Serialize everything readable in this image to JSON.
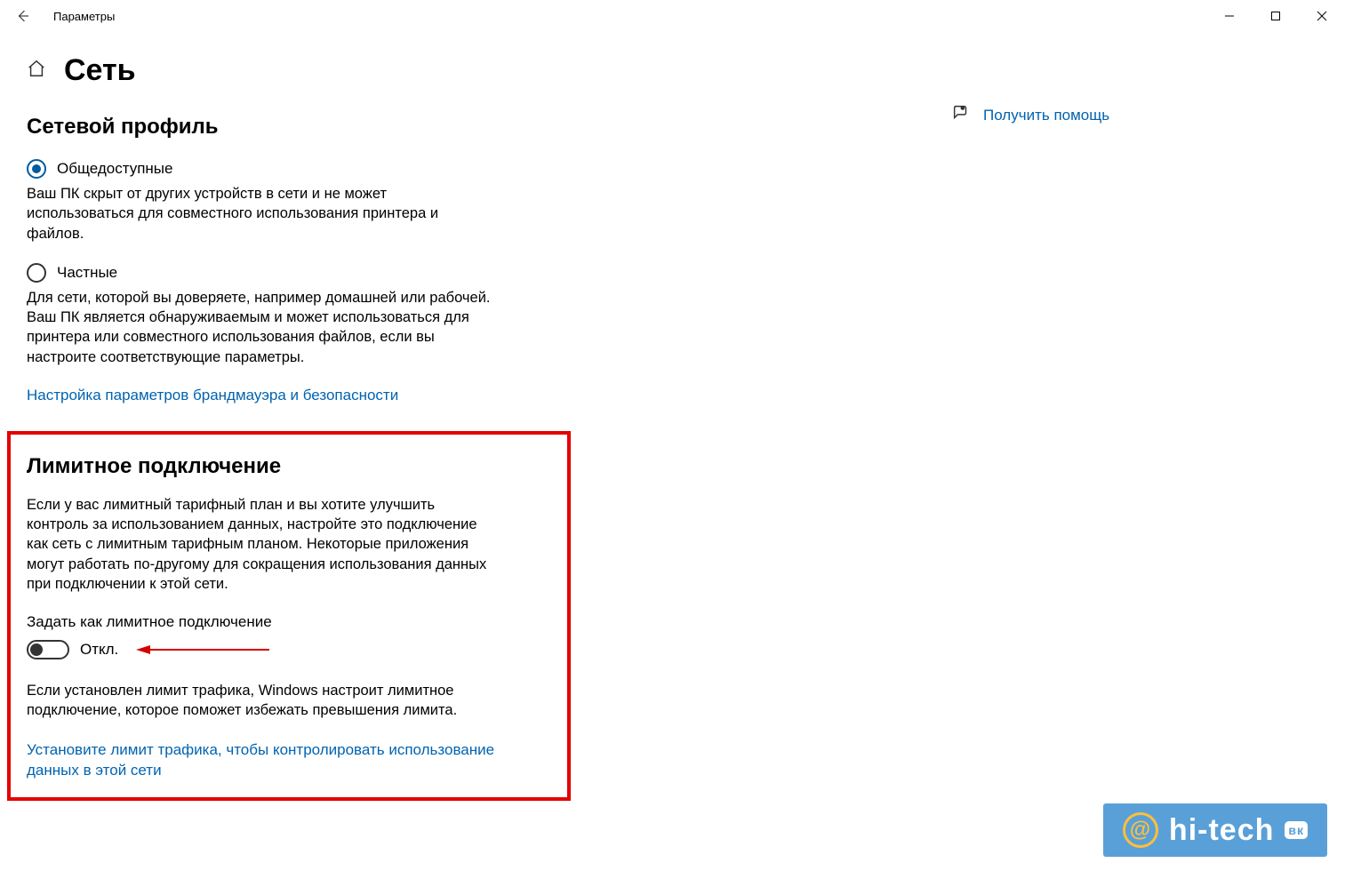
{
  "window": {
    "title": "Параметры"
  },
  "page": {
    "title": "Сеть"
  },
  "network_profile": {
    "heading": "Сетевой профиль",
    "public": {
      "label": "Общедоступные",
      "desc": "Ваш ПК скрыт от других устройств в сети и не может использоваться для совместного использования принтера и файлов."
    },
    "private": {
      "label": "Частные",
      "desc": "Для сети, которой вы доверяете, например домашней или рабочей. Ваш ПК является обнаруживаемым и может использоваться для принтера или совместного использования файлов, если вы настроите соответствующие параметры."
    },
    "firewall_link": "Настройка параметров брандмауэра и безопасности"
  },
  "metered": {
    "heading": "Лимитное подключение",
    "desc": "Если у вас лимитный тарифный план и вы хотите улучшить контроль за использованием данных, настройте это подключение как сеть с лимитным тарифным планом. Некоторые приложения могут работать по-другому для сокращения использования данных при подключении к этой сети.",
    "toggle_label": "Задать как лимитное подключение",
    "toggle_state": "Откл.",
    "info": "Если установлен лимит трафика, Windows настроит лимитное подключение, которое поможет избежать превышения лимита.",
    "set_limit_link": "Установите лимит трафика, чтобы контролировать использование данных в этой сети"
  },
  "help": {
    "link": "Получить помощь"
  },
  "watermark": {
    "text": "hi-tech",
    "badge": "вк"
  }
}
